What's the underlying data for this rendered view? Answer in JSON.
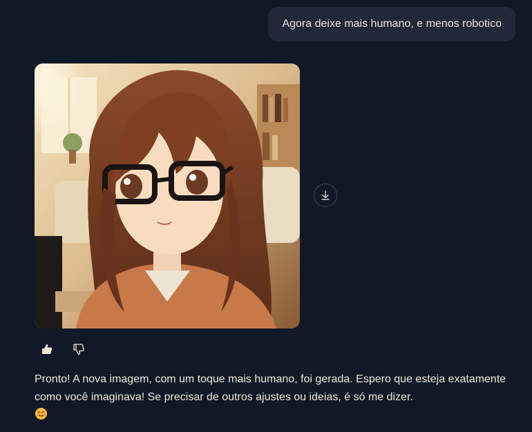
{
  "user_message": {
    "text": "Agora deixe mais humano, e menos robotico"
  },
  "image": {
    "description_icon": "generated-portrait-image"
  },
  "actions": {
    "download_icon": "download-icon",
    "like_icon": "thumbs-up-icon",
    "dislike_icon": "thumbs-down-icon"
  },
  "assistant_message": {
    "text": "Pronto! A nova imagem, com um toque mais humano, foi gerada. Espero que esteja exatamente como você imaginava! Se precisar de outros ajustes ou ideias, é só me dizer.",
    "emoji": "smiling-face-emoji"
  },
  "colors": {
    "background": "#111827",
    "user_bubble": "#222839",
    "text": "#f1e8d8"
  }
}
